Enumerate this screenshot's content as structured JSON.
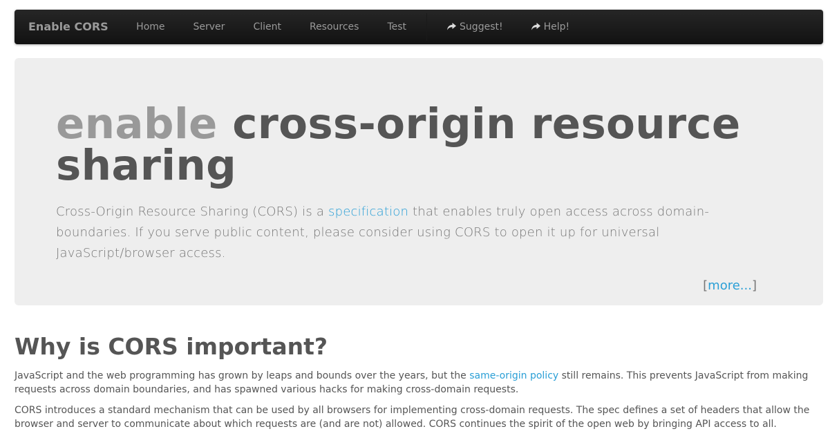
{
  "navbar": {
    "brand": "Enable CORS",
    "items": [
      {
        "label": "Home"
      },
      {
        "label": "Server"
      },
      {
        "label": "Client"
      },
      {
        "label": "Resources"
      },
      {
        "label": "Test"
      }
    ],
    "actions": [
      {
        "label": "Suggest!",
        "icon": "share-icon"
      },
      {
        "label": "Help!",
        "icon": "share-icon"
      }
    ]
  },
  "hero": {
    "title_muted": "enable",
    "title_main": "cross-origin resource sharing",
    "lead_before": "Cross-Origin Resource Sharing (CORS) is a ",
    "lead_link": "specification",
    "lead_after": " that enables truly open access across domain-boundaries. If you serve public content, please consider using CORS to open it up for universal JavaScript/browser access.",
    "more_open": "[",
    "more_link": "more...",
    "more_close": "]"
  },
  "section": {
    "heading": "Why is CORS important?",
    "p1_before": "JavaScript and the web programming has grown by leaps and bounds over the years, but the ",
    "p1_link": "same-origin policy",
    "p1_after": " still remains. This prevents JavaScript from making requests across domain boundaries, and has spawned various hacks for making cross-domain requests.",
    "p2": "CORS introduces a standard mechanism that can be used by all browsers for implementing cross-domain requests. The spec defines a set of headers that allow the browser and server to communicate about which requests are (and are not) allowed. CORS continues the spirit of the open web by bringing API access to all."
  },
  "colors": {
    "navbar_bg": "#1a1a1a",
    "link": "#2a9fd6",
    "hero_bg": "#eeeeee",
    "text": "#555555",
    "muted": "#999999"
  }
}
